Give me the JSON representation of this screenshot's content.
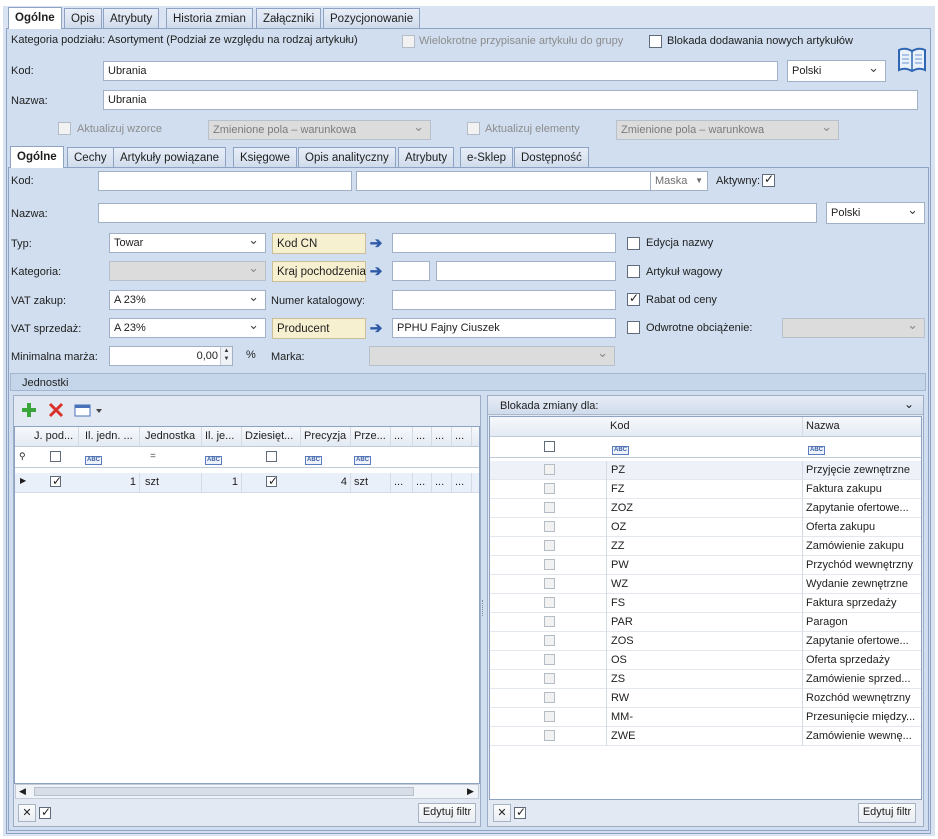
{
  "top_tabs": [
    "Ogólne",
    "Opis",
    "Atrybuty",
    "Historia zmian",
    "Załączniki",
    "Pozycjonowanie"
  ],
  "header": {
    "kategoria_text": "Kategoria podziału: Asortyment (Podział ze względu na rodzaj artykułu)",
    "wielokrotne_label": "Wielokrotne przypisanie artykułu do grupy",
    "blokada_label": "Blokada dodawania nowych artykułów",
    "kod_label": "Kod:",
    "kod_value": "Ubrania",
    "lang_value": "Polski",
    "nazwa_label": "Nazwa:",
    "nazwa_value": "Ubrania",
    "aktualizuj_wzorce_label": "Aktualizuj wzorce",
    "wzorce_select": "Zmienione pola – warunkowa",
    "aktualizuj_elementy_label": "Aktualizuj elementy",
    "elementy_select": "Zmienione pola – warunkowa"
  },
  "inner_tabs": [
    "Ogólne",
    "Cechy",
    "Artykuły powiązane",
    "Księgowe",
    "Opis analityczny",
    "Atrybuty",
    "e-Sklep",
    "Dostępność"
  ],
  "form": {
    "kod_label": "Kod:",
    "kod_value": "",
    "kod_value2": "",
    "maska_label": "Maska",
    "aktywny_label": "Aktywny:",
    "nazwa_label": "Nazwa:",
    "nazwa_value": "",
    "lang_value": "Polski",
    "typ_label": "Typ:",
    "typ_value": "Towar",
    "kategoria_label": "Kategoria:",
    "kategoria_value": "",
    "vat_zakup_label": "VAT zakup:",
    "vat_zakup_value": "A 23%",
    "vat_sprzedaz_label": "VAT sprzedaż:",
    "vat_sprzedaz_value": "A 23%",
    "min_marza_label": "Minimalna marża:",
    "min_marza_value": "0,00",
    "percent": "%",
    "kod_cn_label": "Kod CN",
    "kod_cn_value": "",
    "kraj_label": "Kraj pochodzenia",
    "kraj_code": "",
    "kraj_value": "",
    "numer_kat_label": "Numer katalogowy:",
    "numer_kat_value": "",
    "producent_label": "Producent",
    "producent_value": "PPHU Fajny Ciuszek",
    "marka_label": "Marka:",
    "marka_value": "",
    "edycja_nazwy_label": "Edycja nazwy",
    "artykul_wagowy_label": "Artykuł wagowy",
    "rabat_label": "Rabat od ceny",
    "odwrotne_label": "Odwrotne obciążenie:"
  },
  "jednostki": {
    "title": "Jednostki",
    "columns": [
      "J. pod...",
      "Il. jedn. ...",
      "Jednostka",
      "Il. je...",
      "Dziesięt...",
      "Precyzja",
      "Prze...",
      "...",
      "...",
      "...",
      "..."
    ],
    "row": {
      "il_jedn": "1",
      "jednostka": "szt",
      "il_je": "1",
      "precyzja": "4",
      "prze": "szt",
      "d1": "...",
      "d2": "...",
      "d3": "...",
      "d4": "..."
    },
    "edytuj_filtr": "Edytuj filtr"
  },
  "blokada": {
    "title": "Blokada zmiany dla:",
    "col_kod": "Kod",
    "col_nazwa": "Nazwa",
    "rows": [
      {
        "kod": "PZ",
        "nazwa": "Przyjęcie zewnętrzne"
      },
      {
        "kod": "FZ",
        "nazwa": "Faktura zakupu"
      },
      {
        "kod": "ZOZ",
        "nazwa": "Zapytanie ofertowe..."
      },
      {
        "kod": "OZ",
        "nazwa": "Oferta zakupu"
      },
      {
        "kod": "ZZ",
        "nazwa": "Zamówienie zakupu"
      },
      {
        "kod": "PW",
        "nazwa": "Przychód wewnętrzny"
      },
      {
        "kod": "WZ",
        "nazwa": "Wydanie zewnętrzne"
      },
      {
        "kod": "FS",
        "nazwa": "Faktura sprzedaży"
      },
      {
        "kod": "PAR",
        "nazwa": "Paragon"
      },
      {
        "kod": "ZOS",
        "nazwa": "Zapytanie ofertowe..."
      },
      {
        "kod": "OS",
        "nazwa": "Oferta sprzedaży"
      },
      {
        "kod": "ZS",
        "nazwa": "Zamówienie sprzed..."
      },
      {
        "kod": "RW",
        "nazwa": "Rozchód wewnętrzny"
      },
      {
        "kod": "MM-",
        "nazwa": "Przesunięcie między..."
      },
      {
        "kod": "ZWE",
        "nazwa": "Zamówienie wewnę..."
      }
    ],
    "edytuj_filtr": "Edytuj filtr"
  },
  "colors": {
    "accent": "#2e5aa8",
    "panel": "#d0deef",
    "add": "#3aa53a",
    "delete": "#d8322b"
  }
}
